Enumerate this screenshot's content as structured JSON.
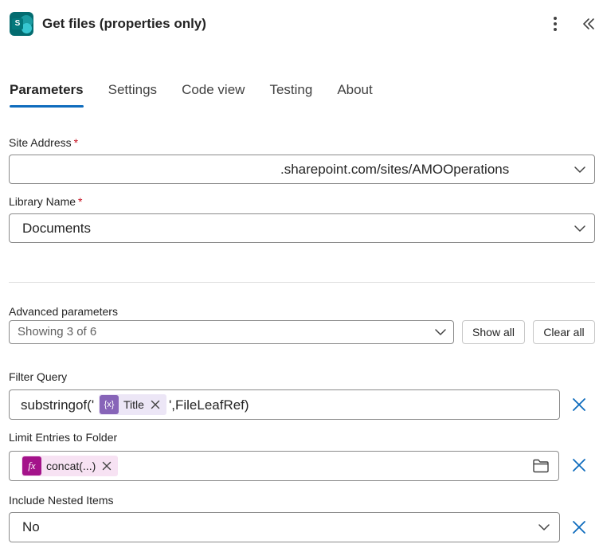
{
  "header": {
    "title": "Get files (properties only)",
    "app_icon_letter": "S"
  },
  "tabs": [
    {
      "label": "Parameters",
      "active": true
    },
    {
      "label": "Settings",
      "active": false
    },
    {
      "label": "Code view",
      "active": false
    },
    {
      "label": "Testing",
      "active": false
    },
    {
      "label": "About",
      "active": false
    }
  ],
  "site_address": {
    "label": "Site Address",
    "required_mark": "*",
    "value": ".sharepoint.com/sites/AMOOperations"
  },
  "library_name": {
    "label": "Library Name",
    "required_mark": "*",
    "value": "Documents"
  },
  "advanced": {
    "label": "Advanced parameters",
    "selected": "Showing 3 of 6",
    "show_all_label": "Show all",
    "clear_all_label": "Clear all"
  },
  "filter_query": {
    "label": "Filter Query",
    "prefix": "substringof('",
    "token_label": "Title",
    "token_icon": "{x}",
    "suffix": "',FileLeafRef)"
  },
  "limit_folder": {
    "label": "Limit Entries to Folder",
    "token_label": "concat(...)",
    "token_icon": "fx"
  },
  "nested": {
    "label": "Include Nested Items",
    "value": "No"
  },
  "colors": {
    "accent": "#0f6cbd",
    "required": "#c50f1f",
    "variable_token": "#8764b8",
    "variable_token_bg": "#ece6f6",
    "expression_token": "#a4138a",
    "expression_token_bg": "#f7e2f3"
  }
}
